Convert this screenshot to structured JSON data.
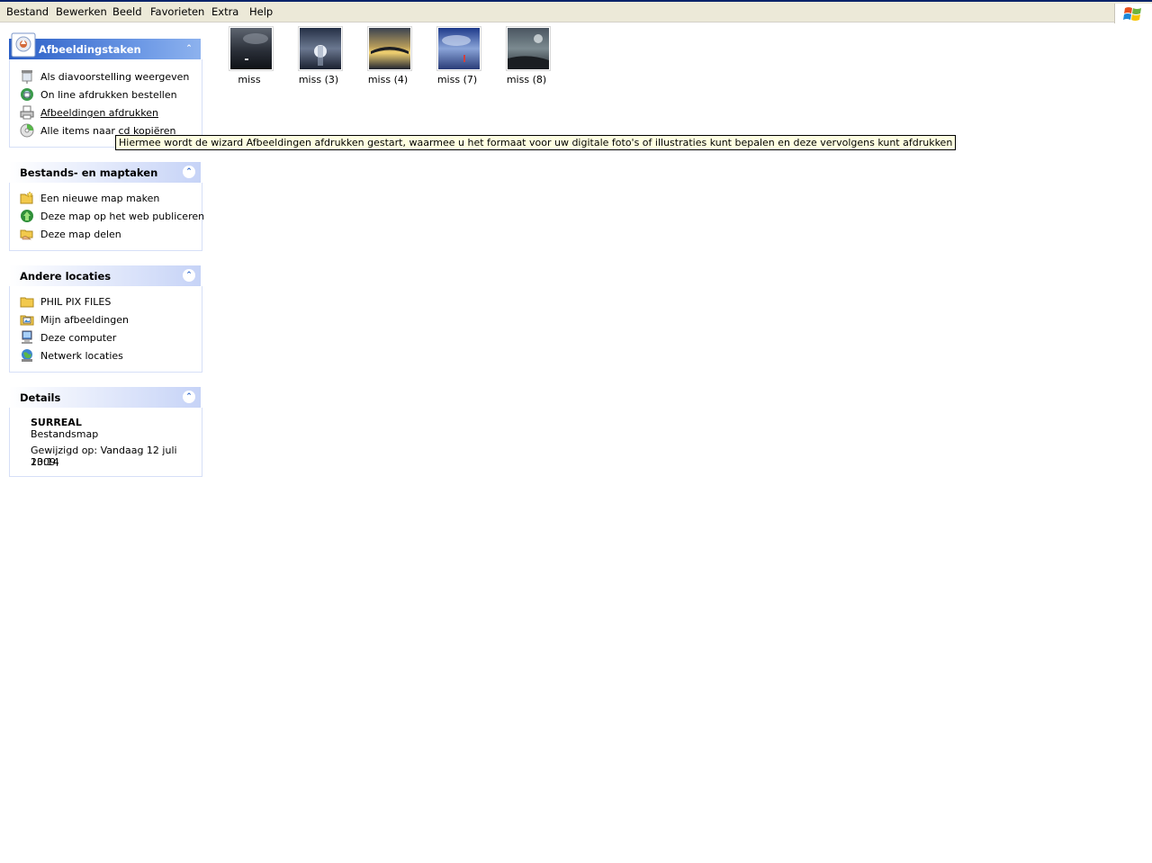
{
  "menu": {
    "items": [
      {
        "label": "Bestand"
      },
      {
        "label": "Bewerken"
      },
      {
        "label": "Beeld"
      },
      {
        "label": "Favorieten"
      },
      {
        "label": "Extra"
      },
      {
        "label": "Help"
      }
    ],
    "logo_icon": "windows-flag-icon"
  },
  "panels": {
    "image_tasks": {
      "title": "Afbeeldingstaken",
      "icon": "picture-tasks-icon",
      "items": [
        {
          "label": "Als diavoorstelling weergeven",
          "icon": "slideshow-icon"
        },
        {
          "label": "On line afdrukken bestellen",
          "icon": "online-print-icon"
        },
        {
          "label": "Afbeeldingen afdrukken",
          "icon": "printer-icon"
        },
        {
          "label": "Alle items naar cd kopiëren",
          "icon": "cd-copy-icon"
        }
      ]
    },
    "file_tasks": {
      "title": "Bestands- en maptaken",
      "items": [
        {
          "label": "Een nieuwe map maken",
          "icon": "new-folder-icon"
        },
        {
          "label": "Deze map op het web publiceren",
          "icon": "publish-web-icon"
        },
        {
          "label": "Deze map delen",
          "icon": "share-folder-icon"
        }
      ]
    },
    "other_places": {
      "title": "Andere locaties",
      "items": [
        {
          "label": "PHIL PIX FILES",
          "icon": "folder-icon"
        },
        {
          "label": "Mijn afbeeldingen",
          "icon": "my-pictures-icon"
        },
        {
          "label": "Deze computer",
          "icon": "computer-icon"
        },
        {
          "label": "Netwerk locaties",
          "icon": "network-icon"
        }
      ]
    },
    "details": {
      "title": "Details",
      "name": "SURREAL",
      "type": "Bestandsmap",
      "modified_1": "Gewijzigd op: Vandaag 12 juli 2009,",
      "modified_2": "13:14"
    }
  },
  "files": [
    {
      "name": "miss"
    },
    {
      "name": "miss (3)"
    },
    {
      "name": "miss (4)"
    },
    {
      "name": "miss (7)"
    },
    {
      "name": "miss (8)"
    }
  ],
  "tooltip": "Hiermee wordt de wizard Afbeeldingen afdrukken gestart, waarmee u het formaat voor uw digitale foto's of illustraties kunt bepalen en deze vervolgens kunt afdrukken",
  "colors": {
    "menubar": "#ece9d8",
    "panel_header_blue": "#2a5ec6",
    "panel_border": "#d6dff7",
    "tooltip_bg": "#ffffe1"
  }
}
